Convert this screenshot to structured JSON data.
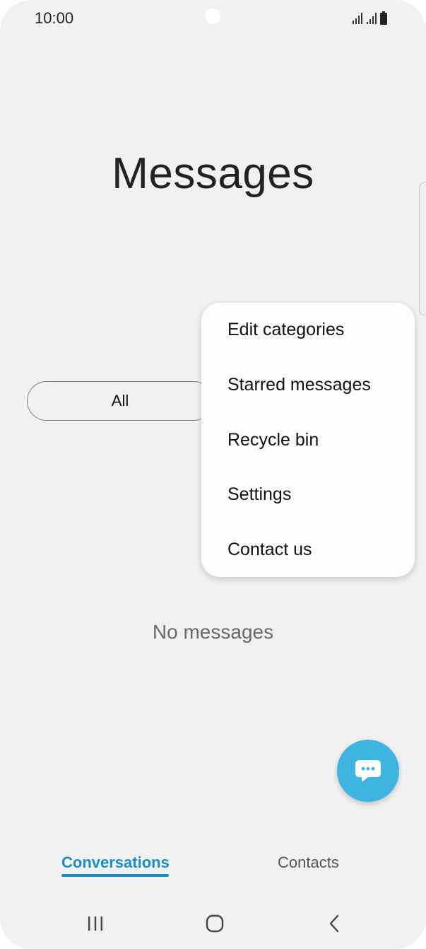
{
  "status_bar": {
    "time": "10:00"
  },
  "header": {
    "title": "Messages"
  },
  "filter": {
    "selected_label": "All"
  },
  "overflow_menu": {
    "items": [
      {
        "label": "Edit categories"
      },
      {
        "label": "Starred messages"
      },
      {
        "label": "Recycle bin"
      },
      {
        "label": "Settings"
      },
      {
        "label": "Contact us"
      }
    ]
  },
  "main": {
    "empty_text": "No messages"
  },
  "bottom_tabs": [
    {
      "label": "Conversations",
      "active": true
    },
    {
      "label": "Contacts",
      "active": false
    }
  ],
  "fab": {
    "icon": "chat-bubble-icon"
  },
  "nav_bar": {
    "icons": [
      "recent-apps-icon",
      "home-icon",
      "back-icon"
    ]
  },
  "colors": {
    "accent": "#1a8fc2",
    "fab": "#3fb3e1",
    "background": "#f1f1f1",
    "menu_background": "#fcfcfc"
  }
}
